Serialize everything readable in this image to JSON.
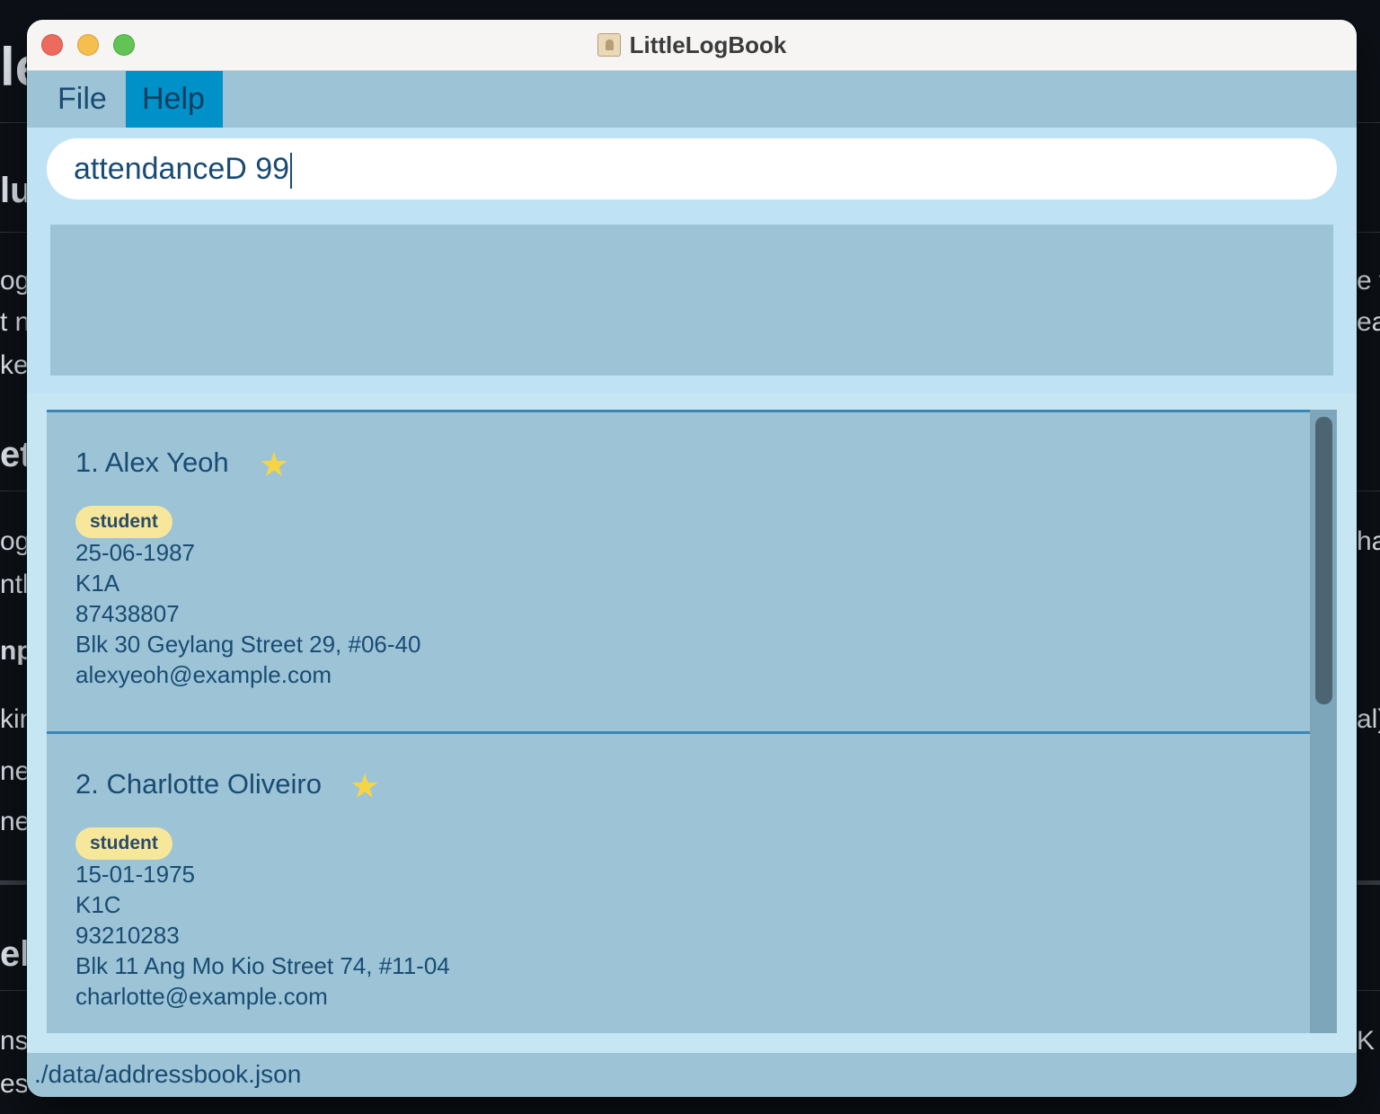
{
  "window": {
    "title": "LittleLogBook"
  },
  "menu": {
    "file_label": "File",
    "help_label": "Help"
  },
  "command": {
    "value": "attendanceD 99"
  },
  "result": {
    "text": ""
  },
  "persons": [
    {
      "index_name": "1. Alex Yeoh",
      "starred": true,
      "tag": "student",
      "dob": "25-06-1987",
      "class": "K1A",
      "phone": "87438807",
      "address": "Blk 30 Geylang Street 29, #06-40",
      "email": "alexyeoh@example.com"
    },
    {
      "index_name": "2. Charlotte Oliveiro",
      "starred": true,
      "tag": "student",
      "dob": "15-01-1975",
      "class": "K1C",
      "phone": "93210283",
      "address": "Blk 11 Ang Mo Kio Street 74, #11-04",
      "email": "charlotte@example.com"
    }
  ],
  "status": {
    "file_path": "./data/addressbook.json"
  },
  "icons": {
    "star": "star-icon",
    "app": "address-book-icon"
  },
  "colors": {
    "star": "#f5d547",
    "menu_highlight": "#0091c8",
    "panel": "#9cc3d6",
    "tag": "#f7e79a"
  }
}
